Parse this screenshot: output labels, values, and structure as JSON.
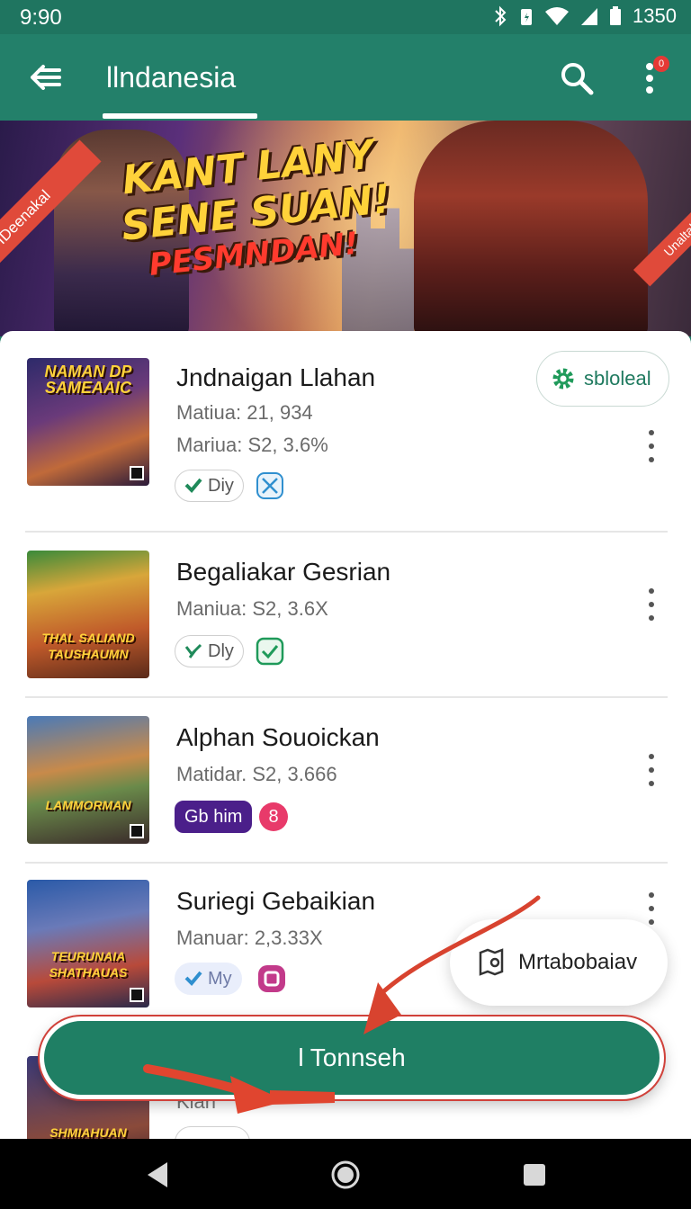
{
  "status_bar": {
    "time": "9:90",
    "battery": "1350"
  },
  "app_bar": {
    "title": "llndanesia",
    "notification_count": "0"
  },
  "banner": {
    "headline_line1": "KANT LANY",
    "headline_line2": "SENE SUAN!",
    "headline_line3": "PESMNDAN!",
    "ribbon_left": "IDeenakal",
    "ribbon_right": "Unaltal"
  },
  "download_pill": {
    "label": "sbloleal"
  },
  "games": [
    {
      "name": "Jndnaigan Llahan",
      "meta1": "Matiua: 21, 934",
      "meta2": "Mariua: S2, 3.6%",
      "chip": "Diy",
      "thumb_caption": "NAMAN DP SAMEAAIC"
    },
    {
      "name": "Begaliakar Gesrian",
      "meta1": "Maniua: S2, 3.6X",
      "chip": "Dly",
      "thumb_caption": "THAL SALIAND TAUSHAUMN"
    },
    {
      "name": "Alphan Souoickan",
      "meta1": "Matidar. S2, 3.666",
      "chip": "Gb him",
      "badge": "8",
      "thumb_caption": "LAMMORMAN"
    },
    {
      "name": "Suriegi Gebaikian",
      "meta1": "Manuar: 2,3.33X",
      "chip": "My",
      "thumb_caption": "TEURUNAIA SHATHAUAS"
    },
    {
      "name": "Kian",
      "thumb_caption": "SHMIAHUAN"
    }
  ],
  "floating_card": {
    "label": "Mrtabobaiav"
  },
  "cta_button": {
    "label": "l Tonnseh"
  },
  "colors": {
    "primary": "#23806a",
    "accent_red": "#e04a3a",
    "chip_purple": "#4b1f8a"
  }
}
